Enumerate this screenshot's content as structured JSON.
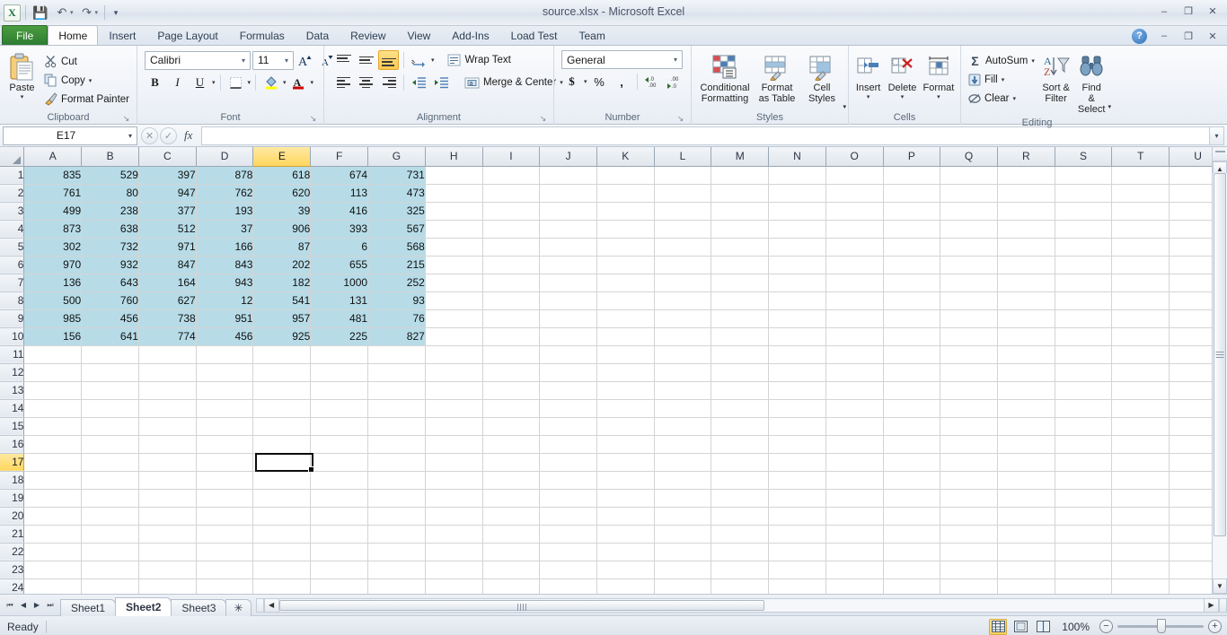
{
  "window": {
    "title": "source.xlsx  -  Microsoft Excel",
    "minimize": "–",
    "restore": "❐",
    "close": "✕",
    "inner_minimize": "–",
    "inner_restore": "❐",
    "inner_close": "✕",
    "help": "?"
  },
  "qat": {
    "logo": "X",
    "save": "💾",
    "undo": "↶",
    "redo": "↷",
    "customize": "▾",
    "dropdown_small": "▾"
  },
  "tabs": [
    {
      "label": "File",
      "active": false,
      "file": true
    },
    {
      "label": "Home",
      "active": true,
      "file": false
    },
    {
      "label": "Insert",
      "active": false,
      "file": false
    },
    {
      "label": "Page Layout",
      "active": false,
      "file": false
    },
    {
      "label": "Formulas",
      "active": false,
      "file": false
    },
    {
      "label": "Data",
      "active": false,
      "file": false
    },
    {
      "label": "Review",
      "active": false,
      "file": false
    },
    {
      "label": "View",
      "active": false,
      "file": false
    },
    {
      "label": "Add-Ins",
      "active": false,
      "file": false
    },
    {
      "label": "Load Test",
      "active": false,
      "file": false
    },
    {
      "label": "Team",
      "active": false,
      "file": false
    }
  ],
  "ribbon": {
    "clipboard": {
      "group_label": "Clipboard",
      "paste": "Paste",
      "cut": "Cut",
      "copy": "Copy",
      "format_painter": "Format Painter",
      "caret": "▾",
      "launcher": "↘"
    },
    "font": {
      "group_label": "Font",
      "family": "Calibri",
      "size": "11",
      "grow": "A",
      "shrink": "A",
      "bold": "B",
      "italic": "I",
      "underline": "U",
      "borders": "░",
      "fill_color": "◆",
      "font_color": "A",
      "caret": "▾",
      "launcher": "↘"
    },
    "alignment": {
      "group_label": "Alignment",
      "top_align": "top-align",
      "middle_align": "middle-align",
      "bottom_align": "bottom-align",
      "orientation": "⟋",
      "align_left": "align-left",
      "align_center": "align-center",
      "align_right": "align-right",
      "decrease_indent": "←≡",
      "increase_indent": "≡→",
      "wrap_text": "Wrap Text",
      "merge_center": "Merge & Center",
      "caret": "▾",
      "launcher": "↘"
    },
    "number": {
      "group_label": "Number",
      "format": "General",
      "accounting": "$",
      "percent": "%",
      "comma": ",",
      "increase_decimal": ".00",
      "decrease_decimal": ".0",
      "caret": "▾",
      "launcher": "↘"
    },
    "styles": {
      "group_label": "Styles",
      "conditional_formatting": "Conditional Formatting",
      "format_as_table": "Format as Table",
      "cell_styles": "Cell Styles",
      "caret": "▾"
    },
    "cells": {
      "group_label": "Cells",
      "insert": "Insert",
      "delete": "Delete",
      "format": "Format",
      "caret": "▾"
    },
    "editing": {
      "group_label": "Editing",
      "autosum": "AutoSum",
      "autosum_sigma": "Σ",
      "fill": "Fill",
      "clear": "Clear",
      "sort_filter": "Sort & Filter",
      "find_select": "Find & Select",
      "caret": "▾"
    }
  },
  "formula_bar": {
    "name_box": "E17",
    "name_box_caret": "▾",
    "cancel": "✕",
    "enter": "✓",
    "insert_function": "fx",
    "value": "",
    "expand": "▾"
  },
  "grid": {
    "columns": [
      "A",
      "B",
      "C",
      "D",
      "E",
      "F",
      "G",
      "H",
      "I",
      "J",
      "K",
      "L",
      "M",
      "N",
      "O",
      "P",
      "Q",
      "R",
      "S",
      "T",
      "U"
    ],
    "selected_column": "E",
    "selected_row": 17,
    "selected_cell": "E17",
    "row_count": 24,
    "data_rows": [
      [
        "835",
        "529",
        "397",
        "878",
        "618",
        "674",
        "731"
      ],
      [
        "761",
        "80",
        "947",
        "762",
        "620",
        "113",
        "473"
      ],
      [
        "499",
        "238",
        "377",
        "193",
        "39",
        "416",
        "325"
      ],
      [
        "873",
        "638",
        "512",
        "37",
        "906",
        "393",
        "567"
      ],
      [
        "302",
        "732",
        "971",
        "166",
        "87",
        "6",
        "568"
      ],
      [
        "970",
        "932",
        "847",
        "843",
        "202",
        "655",
        "215"
      ],
      [
        "136",
        "643",
        "164",
        "943",
        "182",
        "1000",
        "252"
      ],
      [
        "500",
        "760",
        "627",
        "12",
        "541",
        "131",
        "93"
      ],
      [
        "985",
        "456",
        "738",
        "951",
        "957",
        "481",
        "76"
      ],
      [
        "156",
        "641",
        "774",
        "456",
        "925",
        "225",
        "827"
      ]
    ],
    "filled_fill_color": "#b7dce8",
    "header_selected_color": "#ffd75e"
  },
  "sheet_tabs": {
    "first": "⏮",
    "prev": "◀",
    "next": "▶",
    "last": "⏭",
    "sheets": [
      {
        "label": "Sheet1",
        "active": false
      },
      {
        "label": "Sheet2",
        "active": true
      },
      {
        "label": "Sheet3",
        "active": false
      }
    ],
    "insert_sheet": "✳"
  },
  "scrollbars": {
    "up": "▲",
    "down": "▼",
    "left": "◀",
    "right": "▶"
  },
  "status_bar": {
    "status": "Ready",
    "view_normal": "normal-view",
    "view_page_layout": "page-layout-view",
    "view_page_break": "page-break-view",
    "zoom": "100%",
    "zoom_out": "−",
    "zoom_in": "+"
  }
}
